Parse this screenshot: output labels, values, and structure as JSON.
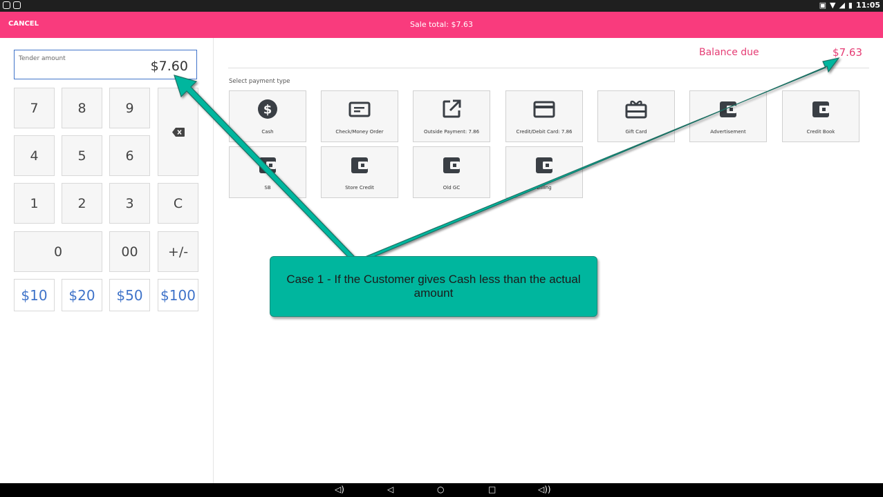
{
  "status_bar": {
    "time": "11:05"
  },
  "app_bar": {
    "cancel_label": "CANCEL",
    "sale_total": "Sale total: $7.63"
  },
  "tender": {
    "label": "Tender amount",
    "value": "$7.60"
  },
  "keypad": {
    "k7": "7",
    "k8": "8",
    "k9": "9",
    "k4": "4",
    "k5": "5",
    "k6": "6",
    "k1": "1",
    "k2": "2",
    "k3": "3",
    "clear": "C",
    "k0": "0",
    "k00": "00",
    "sign": "+/-",
    "cash10": "$10",
    "cash20": "$20",
    "cash50": "$50",
    "cash100": "$100"
  },
  "balance": {
    "label": "Balance due",
    "value": "$7.63"
  },
  "payment": {
    "select_label": "Select payment type",
    "types": [
      {
        "label": "Cash",
        "icon": "dollar-circle-icon"
      },
      {
        "label": "Check/Money Order",
        "icon": "check-icon"
      },
      {
        "label": "Outside Payment: 7.86",
        "icon": "external-link-icon"
      },
      {
        "label": "Credit/Debit Card: 7.86",
        "icon": "credit-card-icon"
      },
      {
        "label": "Gift Card",
        "icon": "gift-card-icon"
      },
      {
        "label": "Advertisement",
        "icon": "wallet-icon"
      },
      {
        "label": "Credit Book",
        "icon": "wallet-icon"
      },
      {
        "label": "SB",
        "icon": "wallet-icon"
      },
      {
        "label": "Store Credit",
        "icon": "wallet-icon"
      },
      {
        "label": "Old GC",
        "icon": "wallet-icon"
      },
      {
        "label": "Billing",
        "icon": "wallet-icon"
      }
    ]
  },
  "callout": {
    "text": "Case 1 - If the Customer gives Cash less than the actual amount"
  },
  "colors": {
    "accent": "#f93b7d",
    "callout": "#00b69e",
    "balance": "#e53c74",
    "keypad_blue": "#3f73c9"
  }
}
